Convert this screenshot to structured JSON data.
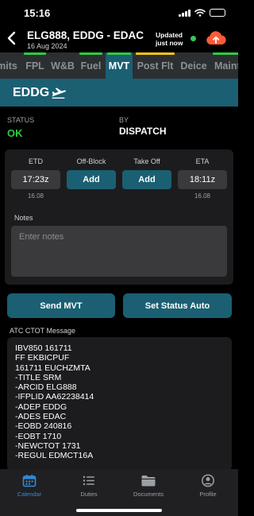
{
  "status_bar": {
    "time": "15:16",
    "icons": [
      "cellular-signal-icon",
      "wifi-icon",
      "battery-icon"
    ]
  },
  "header": {
    "title": "ELG888, EDDG - EDAC",
    "date": "16 Aug 2024",
    "updated_line1": "Updated",
    "updated_line2": "just now",
    "online_color": "#34c759",
    "upload_color": "#ff5a36"
  },
  "tabs": [
    {
      "label": "mits",
      "bar_color": "",
      "active": false
    },
    {
      "label": "FPL",
      "bar_color": "#2ecc40",
      "active": false
    },
    {
      "label": "W&B",
      "bar_color": "",
      "active": false
    },
    {
      "label": "Fuel",
      "bar_color": "#2ecc40",
      "active": false
    },
    {
      "label": "MVT",
      "bar_color": "#2ecc40",
      "active": true
    },
    {
      "label": "Post Flt",
      "bar_color": "#f5c518",
      "active": false
    },
    {
      "label": "Deice",
      "bar_color": "",
      "active": false
    },
    {
      "label": "Maint",
      "bar_color": "#2ecc40",
      "active": false
    }
  ],
  "banner": {
    "airport": "EDDG",
    "icon": "airplane-departure-icon"
  },
  "movement": {
    "status_label": "STATUS",
    "status_value": "OK",
    "status_color": "#2ecc40",
    "by_label": "BY",
    "by_value": "DISPATCH"
  },
  "times": {
    "etd": {
      "label": "ETD",
      "value": "17:23z",
      "date": "16.08"
    },
    "off_block": {
      "label": "Off-Block",
      "button": "Add"
    },
    "take_off": {
      "label": "Take Off",
      "button": "Add"
    },
    "eta": {
      "label": "ETA",
      "value": "18:11z",
      "date": "16.08"
    }
  },
  "notes": {
    "label": "Notes",
    "placeholder": "Enter notes"
  },
  "actions": {
    "send_mvt": "Send MVT",
    "set_status_auto": "Set Status Auto"
  },
  "ctot": {
    "label": "ATC CTOT Message",
    "lines": [
      "IBV850 161711",
      "FF EKBICPUF",
      "161711 EUCHZMTA",
      "-TITLE SRM",
      "-ARCID ELG888",
      "-IFPLID AA62238414",
      "-ADEP EDDG",
      "-ADES EDAC",
      "-EOBD 240816",
      "-EOBT 1710",
      "-NEWCTOT 1731",
      "-REGUL EDMCT16A"
    ]
  },
  "bottom_nav": {
    "active_color": "#2f8bd8",
    "items": [
      {
        "label": "Calendar",
        "icon": "calendar-icon",
        "active": true
      },
      {
        "label": "Duties",
        "icon": "list-icon",
        "active": false
      },
      {
        "label": "Documents",
        "icon": "folder-icon",
        "active": false
      },
      {
        "label": "Profile",
        "icon": "profile-icon",
        "active": false
      }
    ]
  },
  "theme": {
    "accent": "#1b5f73",
    "background": "#000000",
    "card": "#1c1c1e"
  }
}
